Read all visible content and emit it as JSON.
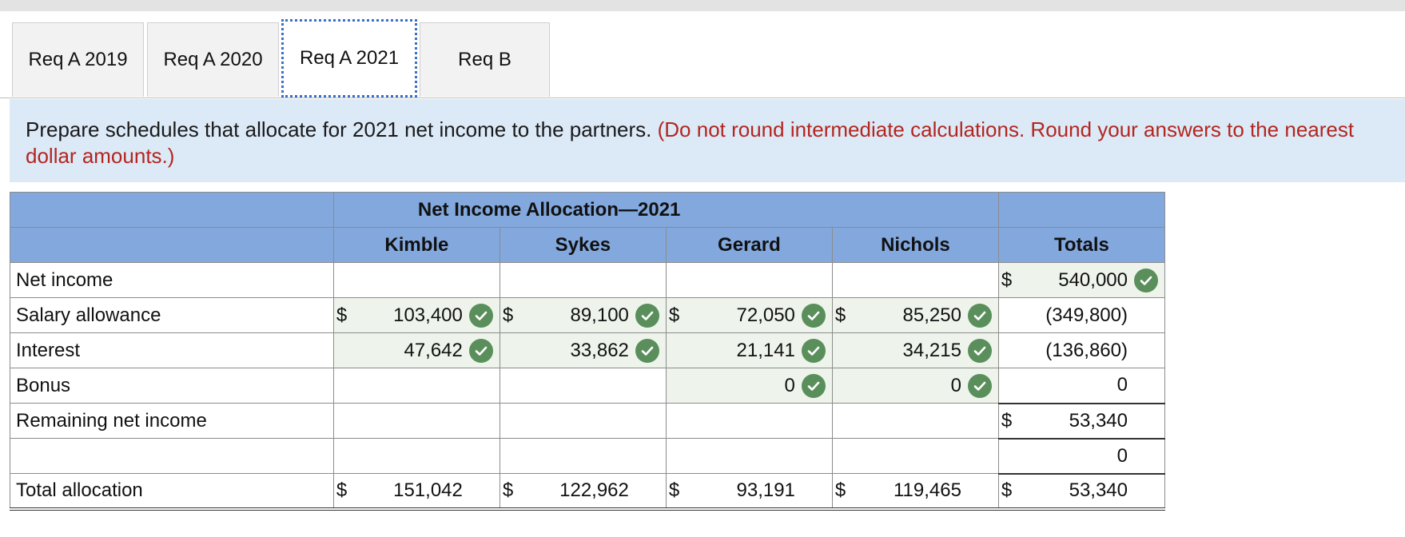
{
  "tabs": [
    {
      "label": "Req A 2019",
      "active": false
    },
    {
      "label": "Req A 2020",
      "active": false
    },
    {
      "label": "Req A 2021",
      "active": true
    },
    {
      "label": "Req B",
      "active": false
    }
  ],
  "instruction": {
    "text": "Prepare schedules that allocate for 2021 net income to the partners.",
    "note": "(Do not round intermediate calculations. Round your answers to the nearest dollar amounts.)"
  },
  "table": {
    "title": "Net Income Allocation—2021",
    "columns": [
      "Kimble",
      "Sykes",
      "Gerard",
      "Nichols",
      "Totals"
    ],
    "rows": [
      {
        "label": "Net income",
        "cells": [
          {
            "dollar": "",
            "value": "",
            "check": false
          },
          {
            "dollar": "",
            "value": "",
            "check": false
          },
          {
            "dollar": "",
            "value": "",
            "check": false
          },
          {
            "dollar": "",
            "value": "",
            "check": false
          },
          {
            "dollar": "$",
            "value": "540,000",
            "check": true
          }
        ]
      },
      {
        "label": "Salary allowance",
        "cells": [
          {
            "dollar": "$",
            "value": "103,400",
            "check": true
          },
          {
            "dollar": "$",
            "value": "89,100",
            "check": true
          },
          {
            "dollar": "$",
            "value": "72,050",
            "check": true
          },
          {
            "dollar": "$",
            "value": "85,250",
            "check": true
          },
          {
            "dollar": "",
            "value": "(349,800)",
            "check": false
          }
        ]
      },
      {
        "label": "Interest",
        "cells": [
          {
            "dollar": "",
            "value": "47,642",
            "check": true
          },
          {
            "dollar": "",
            "value": "33,862",
            "check": true
          },
          {
            "dollar": "",
            "value": "21,141",
            "check": true
          },
          {
            "dollar": "",
            "value": "34,215",
            "check": true
          },
          {
            "dollar": "",
            "value": "(136,860)",
            "check": false
          }
        ]
      },
      {
        "label": "Bonus",
        "cells": [
          {
            "dollar": "",
            "value": "",
            "check": false
          },
          {
            "dollar": "",
            "value": "",
            "check": false
          },
          {
            "dollar": "",
            "value": "0",
            "check": true
          },
          {
            "dollar": "",
            "value": "0",
            "check": true
          },
          {
            "dollar": "",
            "value": "0",
            "check": false
          }
        ]
      },
      {
        "label": "Remaining net income",
        "cells": [
          {
            "dollar": "",
            "value": "",
            "check": false
          },
          {
            "dollar": "",
            "value": "",
            "check": false
          },
          {
            "dollar": "",
            "value": "",
            "check": false
          },
          {
            "dollar": "",
            "value": "",
            "check": false
          },
          {
            "dollar": "$",
            "value": "53,340",
            "check": false
          }
        ]
      },
      {
        "label": "",
        "cells": [
          {
            "dollar": "",
            "value": "",
            "check": false
          },
          {
            "dollar": "",
            "value": "",
            "check": false
          },
          {
            "dollar": "",
            "value": "",
            "check": false
          },
          {
            "dollar": "",
            "value": "",
            "check": false
          },
          {
            "dollar": "",
            "value": "0",
            "check": false
          }
        ]
      },
      {
        "label": "Total allocation",
        "cells": [
          {
            "dollar": "$",
            "value": "151,042",
            "check": false
          },
          {
            "dollar": "$",
            "value": "122,962",
            "check": false
          },
          {
            "dollar": "$",
            "value": "93,191",
            "check": false
          },
          {
            "dollar": "$",
            "value": "119,465",
            "check": false
          },
          {
            "dollar": "$",
            "value": "53,340",
            "check": false
          }
        ]
      }
    ]
  },
  "colors": {
    "header_bg": "#82a8de",
    "instruction_bg": "#dce9f7",
    "note_red": "#b3261e",
    "check_green": "#5a8f5c"
  }
}
